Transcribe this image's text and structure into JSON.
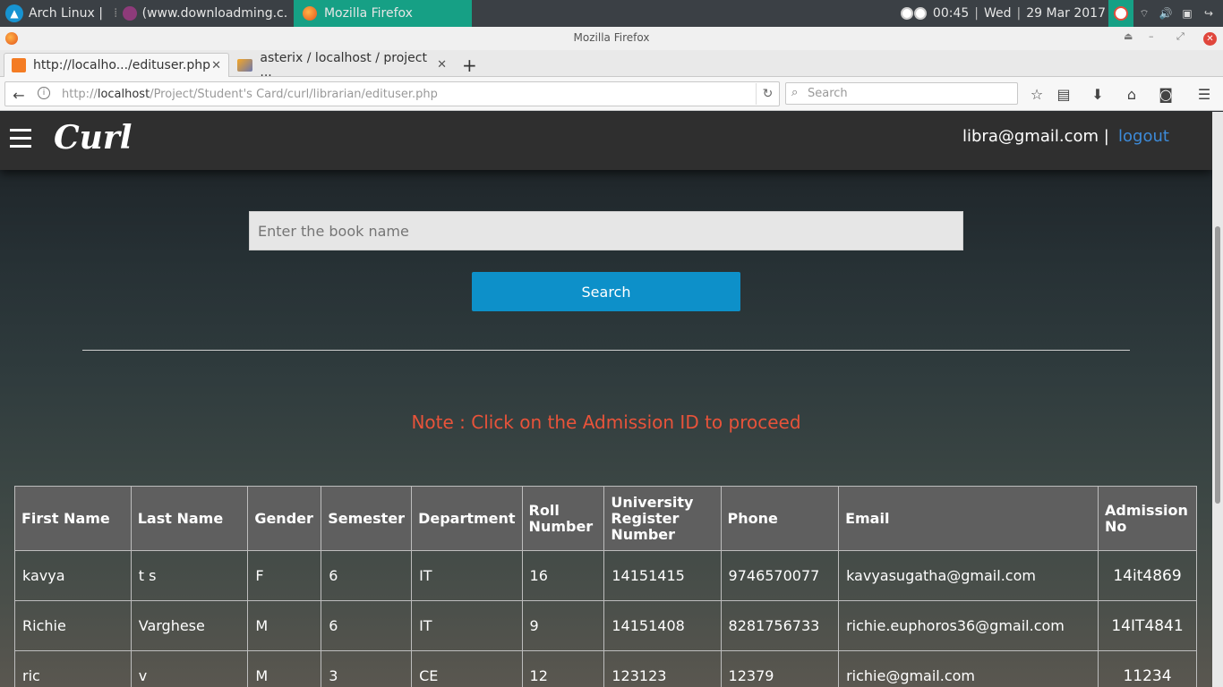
{
  "system_panel": {
    "workspace": "Arch Linux |",
    "other_window": "(www.downloadming.c...",
    "active_window": "Mozilla Firefox",
    "time": "00:45",
    "day": "Wed",
    "sep": "|",
    "date": "29 Mar 2017"
  },
  "firefox": {
    "window_title": "Mozilla Firefox",
    "tabs": [
      {
        "label": "http://localho.../edituser.php"
      },
      {
        "label": "asterix / localhost / project ..."
      }
    ],
    "url_prefix": "http://",
    "url_host": "localhost",
    "url_path": "/Project/Student's Card/curl/librarian/edituser.php",
    "search_placeholder": "Search"
  },
  "site": {
    "brand": "Curl",
    "user_email": "libra@gmail.com |",
    "logout": "logout",
    "book_placeholder": "Enter the book name",
    "search_button": "Search",
    "note": "Note : Click on the Admission ID to proceed"
  },
  "table": {
    "headers": [
      "First Name",
      "Last Name",
      "Gender",
      "Semester",
      "Department",
      "Roll Number",
      "University Register Number",
      "Phone",
      "Email",
      "Admission No"
    ],
    "rows": [
      [
        "kavya",
        "t s",
        "F",
        "6",
        "IT",
        "16",
        "14151415",
        "9746570077",
        "kavyasugatha@gmail.com",
        "14it4869"
      ],
      [
        "Richie",
        "Varghese",
        "M",
        "6",
        "IT",
        "9",
        "14151408",
        "8281756733",
        "richie.euphoros36@gmail.com",
        "14IT4841"
      ],
      [
        "ric",
        "v",
        "M",
        "3",
        "CE",
        "12",
        "123123",
        "12379",
        "richie@gmail.com",
        "11234"
      ]
    ]
  }
}
